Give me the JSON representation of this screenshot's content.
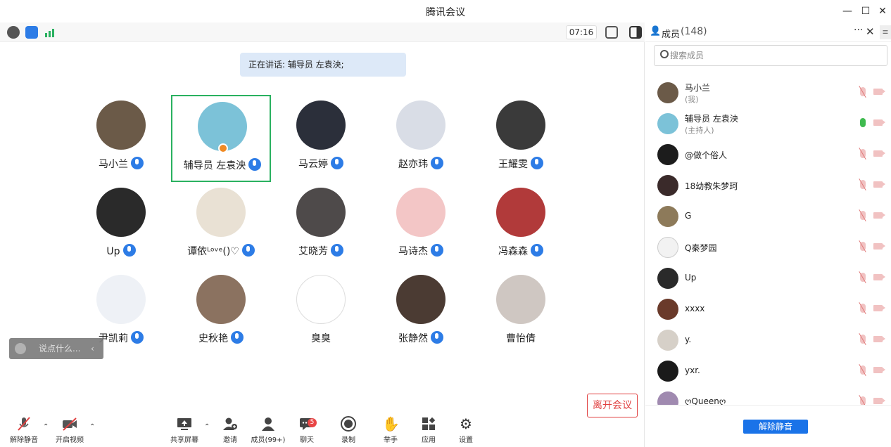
{
  "window": {
    "title": "腾讯会议",
    "minimize": "—",
    "maximize": "☐",
    "close": "✕"
  },
  "topbar": {
    "timer": "07:16"
  },
  "speaking": "正在讲话: 辅导员 左袁泱;",
  "participants": [
    {
      "name": "马小兰",
      "color": "#6b5a48"
    },
    {
      "name": "辅导员 左袁泱",
      "color": "#7cc2d8",
      "active": true
    },
    {
      "name": "马云婷",
      "color": "#2b2f3a"
    },
    {
      "name": "赵亦玮",
      "color": "#d9dde6"
    },
    {
      "name": "王耀雯",
      "color": "#3a3a3a"
    },
    {
      "name": "Up",
      "color": "#2a2a2a"
    },
    {
      "name": "谭依ᴸᵒᵛᵉ()♡",
      "color": "#e9e1d4"
    },
    {
      "name": "艾晓芳",
      "color": "#4e4a4a"
    },
    {
      "name": "马诗杰",
      "color": "#f3c6c6"
    },
    {
      "name": "冯森森",
      "color": "#b13a3a"
    },
    {
      "name": "尹凯莉",
      "color": "#eef1f6"
    },
    {
      "name": "史秋艳",
      "color": "#8b7260"
    },
    {
      "name": "臭臭",
      "color": "#ffffff"
    },
    {
      "name": "张静然",
      "color": "#4b3b33"
    },
    {
      "name": "曹怡倩",
      "color": "#cfc7c2"
    }
  ],
  "chat": {
    "placeholder": "说点什么...",
    "arrow": "‹"
  },
  "toolbar": {
    "unmute": "解除静音",
    "video": "开启视频",
    "share": "共享屏幕",
    "invite": "邀请",
    "members": "成员(99+)",
    "chat": "聊天",
    "chat_badge": "5",
    "record": "录制",
    "raise_hand": "举手",
    "apps": "应用",
    "settings": "设置",
    "leave": "离开会议"
  },
  "panel": {
    "title": "成员",
    "count": "(148)",
    "more": "···",
    "close": "✕",
    "menu": "≡",
    "search_placeholder": "搜索成员",
    "unmute_all": "解除静音",
    "members": [
      {
        "name": "马小兰",
        "role": "(我)",
        "color": "#6b5a48",
        "mic": "off"
      },
      {
        "name": "辅导员 左袁泱",
        "role": "(主持人)",
        "color": "#7cc2d8",
        "mic": "on"
      },
      {
        "name": "@做个俗人",
        "role": "",
        "color": "#1c1c1c",
        "mic": "off"
      },
      {
        "name": "18幼教朱梦珂",
        "role": "",
        "color": "#3a2a2a",
        "mic": "off"
      },
      {
        "name": "G",
        "role": "",
        "color": "#8d7a5a",
        "mic": "off"
      },
      {
        "name": "Q秦梦园",
        "role": "",
        "color": "#f2f2f2",
        "mic": "off"
      },
      {
        "name": "Up",
        "role": "",
        "color": "#2a2a2a",
        "mic": "off"
      },
      {
        "name": "xxxx",
        "role": "",
        "color": "#6a3a2a",
        "mic": "off"
      },
      {
        "name": "y.",
        "role": "",
        "color": "#d6d0c8",
        "mic": "off"
      },
      {
        "name": "yxr.",
        "role": "",
        "color": "#1a1a1a",
        "mic": "off"
      },
      {
        "name": "ღQueenღ",
        "role": "",
        "color": "#a08ab0",
        "mic": "off"
      }
    ]
  }
}
